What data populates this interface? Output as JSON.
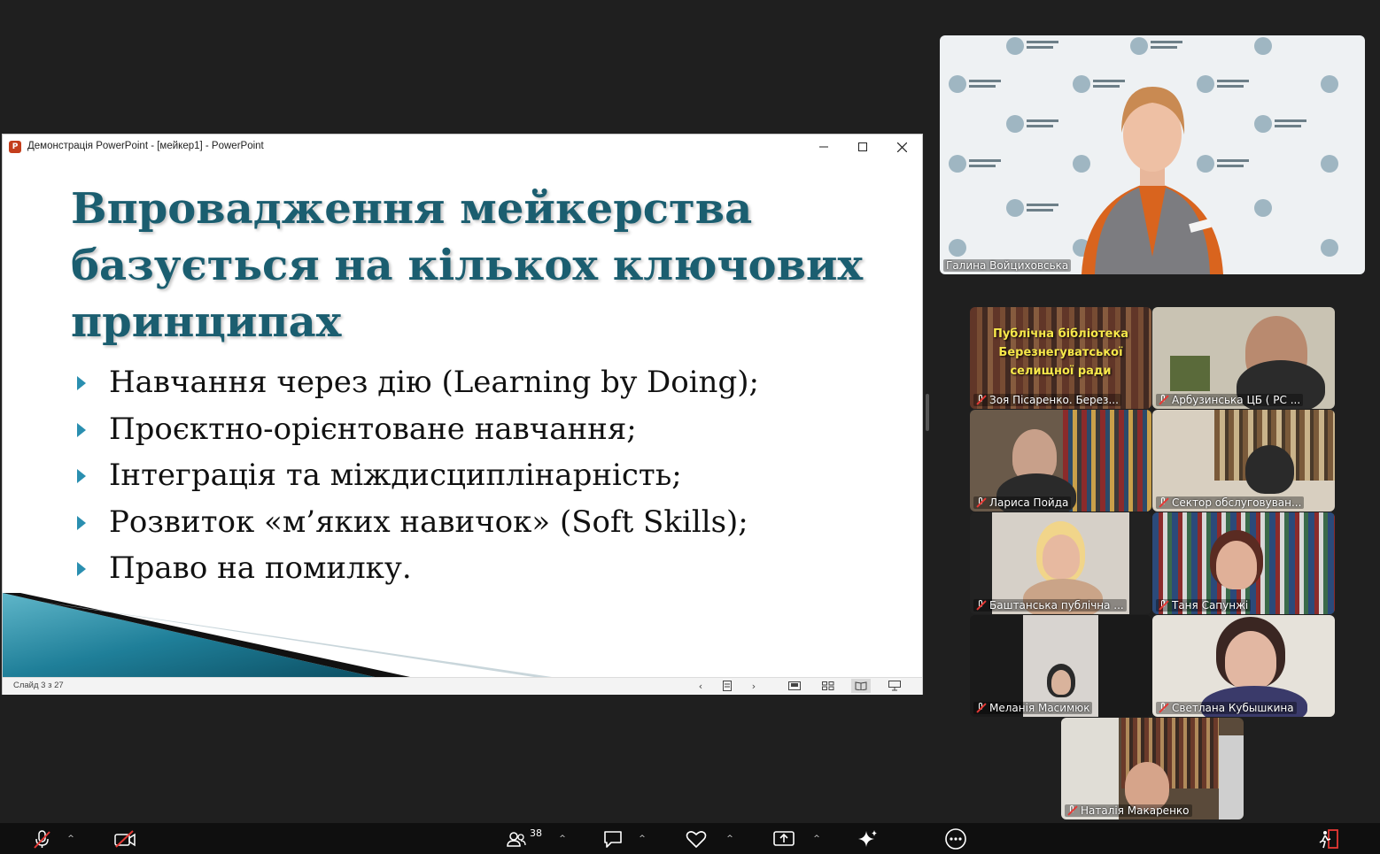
{
  "ppt_window": {
    "title": "Демонстрація PowerPoint - [мейкер1] - PowerPoint",
    "minimize_icon": "minimize-icon",
    "maximize_icon": "maximize-icon",
    "close_icon": "close-icon",
    "slide_counter": "Слайд 3 з 27"
  },
  "slide": {
    "title": "Впровадження мейкерства базується на кількох ключових принципах",
    "bullets": [
      "Навчання через дію (Learning by Doing);",
      "Проєктно-орієнтоване навчання;",
      "Інтеграція та міждисциплінарність;",
      "Розвиток «м’яких навичок» (Soft Skills);",
      "Право на помилку."
    ],
    "accent_color": "#1b5e70"
  },
  "speaker": {
    "name": "Галина Войциховська"
  },
  "participants": [
    {
      "name": "Зоя Пісаренко. Берез...",
      "banner": [
        "Публічна бібліотека",
        "Березнегуватської",
        "селищної ради"
      ]
    },
    {
      "name": "Арбузинська ЦБ ( РС ..."
    },
    {
      "name": "Лариса Пойда"
    },
    {
      "name": "Сектор обслуговуван..."
    },
    {
      "name": "Баштанська публічна ..."
    },
    {
      "name": "Таня Сапунжі"
    },
    {
      "name": "Меланія Масимюк"
    },
    {
      "name": "Светлана Кубышкина"
    },
    {
      "name": "Наталія Макаренко"
    }
  ],
  "toolbar": {
    "participants_count": "38",
    "icons": [
      "mic-muted-icon",
      "camera-off-icon",
      "participants-icon",
      "chat-icon",
      "reactions-icon",
      "share-screen-icon",
      "ai-sparkle-icon",
      "more-icon",
      "leave-icon"
    ]
  }
}
